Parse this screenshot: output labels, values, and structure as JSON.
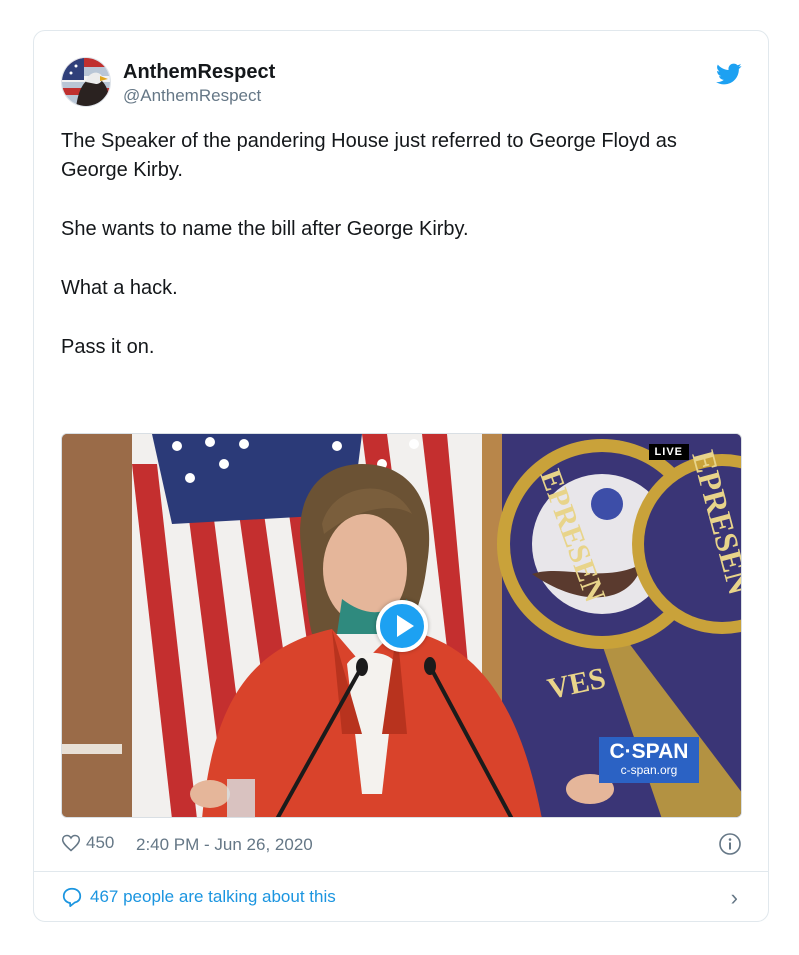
{
  "tweet": {
    "display_name": "AnthemRespect",
    "handle": "@AnthemRespect",
    "paragraphs": [
      "The Speaker of the pandering House just referred to George Floyd as George Kirby.",
      "She wants to name the bill after George Kirby.",
      "What a hack.",
      "Pass it on."
    ],
    "icons": {
      "platform": "twitter-bird-icon",
      "like": "heart-icon",
      "info": "info-icon",
      "reply": "speech-bubble-icon",
      "chevron": "chevron-right-icon",
      "play": "play-icon"
    }
  },
  "video": {
    "live_label": "LIVE",
    "network_logo": "C·SPAN",
    "network_url": "c-span.org",
    "seal_text_left": "EPRESEN",
    "seal_text_right": "EPRESEN",
    "seal_text_bottom": "VES"
  },
  "meta": {
    "likes": "450",
    "timestamp": "2:40 PM - Jun 26, 2020"
  },
  "footer": {
    "talking": "467 people are talking about this"
  },
  "colors": {
    "accent": "#1da1f2",
    "link": "#1b95e0",
    "muted": "#657786",
    "cspan": "#2b62c4",
    "jacket": "#d9432b"
  }
}
